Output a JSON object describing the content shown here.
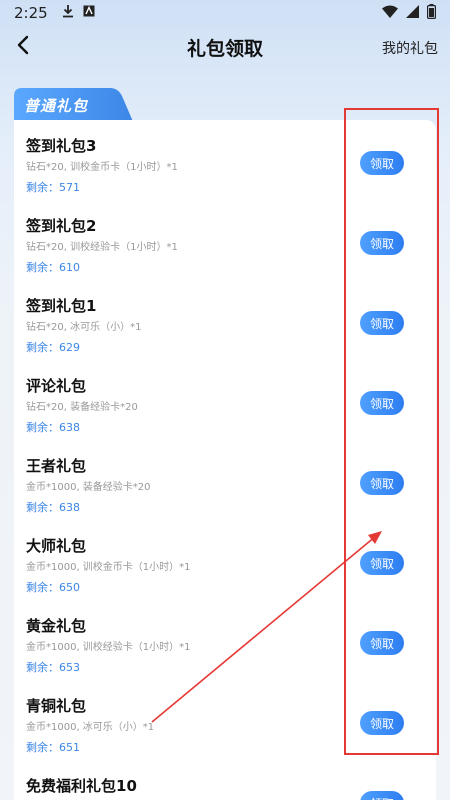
{
  "status_bar": {
    "time": "2:25",
    "icons": [
      "download-icon",
      "a-icon",
      "wifi-icon",
      "signal-icon",
      "battery-icon"
    ]
  },
  "nav": {
    "title": "礼包领取",
    "right_link": "我的礼包"
  },
  "section": {
    "tab_label": "普通礼包"
  },
  "gifts": [
    {
      "name": "签到礼包3",
      "desc": "钻石*20, 训校金币卡（1小时）*1",
      "remain": "剩余：571",
      "button": "领取"
    },
    {
      "name": "签到礼包2",
      "desc": "钻石*20, 训校经验卡（1小时）*1",
      "remain": "剩余：610",
      "button": "领取"
    },
    {
      "name": "签到礼包1",
      "desc": "钻石*20, 冰可乐（小）*1",
      "remain": "剩余：629",
      "button": "领取"
    },
    {
      "name": "评论礼包",
      "desc": "钻石*20, 装备经验卡*20",
      "remain": "剩余：638",
      "button": "领取"
    },
    {
      "name": "王者礼包",
      "desc": "金币*1000, 装备经验卡*20",
      "remain": "剩余：638",
      "button": "领取"
    },
    {
      "name": "大师礼包",
      "desc": "金币*1000, 训校金币卡（1小时）*1",
      "remain": "剩余：650",
      "button": "领取"
    },
    {
      "name": "黄金礼包",
      "desc": "金币*1000, 训校经验卡（1小时）*1",
      "remain": "剩余：653",
      "button": "领取"
    },
    {
      "name": "青铜礼包",
      "desc": "金币*1000, 冰可乐（小）*1",
      "remain": "剩余：651",
      "button": "领取"
    },
    {
      "name": "免费福利礼包10",
      "desc": "",
      "remain": "",
      "button": "领取"
    }
  ],
  "colors": {
    "accent": "#3d86e6",
    "button_start": "#4fa0ff",
    "button_end": "#2e7df0",
    "annotation": "#e53935"
  }
}
